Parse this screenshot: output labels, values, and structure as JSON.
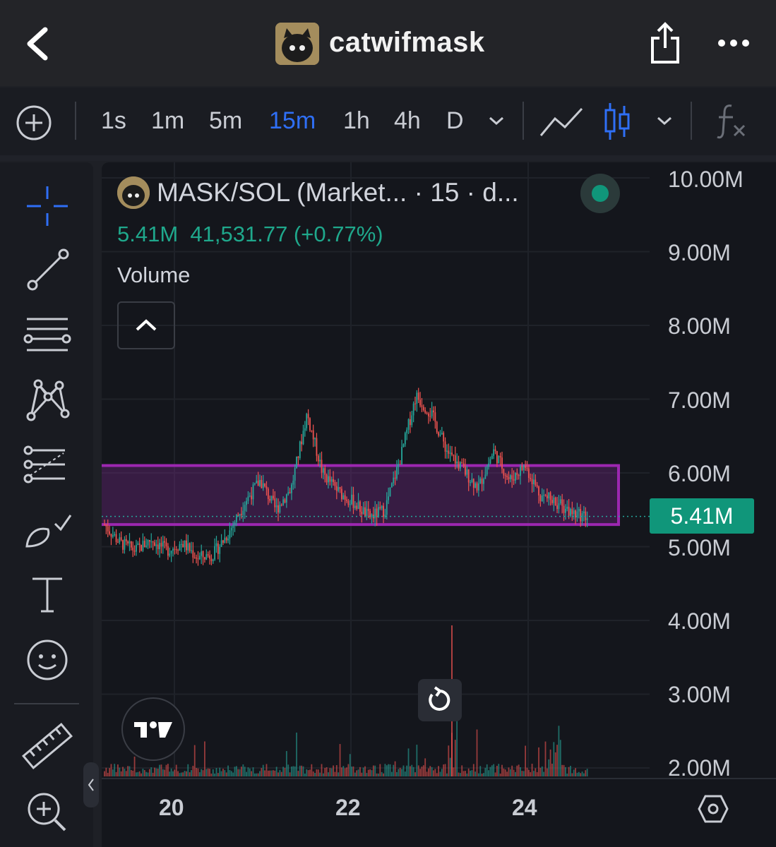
{
  "header": {
    "title": "catwifmask"
  },
  "toolbar": {
    "timeframes": [
      "1s",
      "1m",
      "5m",
      "15m",
      "1h",
      "4h",
      "D"
    ],
    "active_timeframe": "15m",
    "accent_color": "#2f6ff6"
  },
  "legend": {
    "symbol": "MASK/SOL (Market... · 15 · d...",
    "price": "5.41M",
    "change": "41,531.77 (+0.77%)",
    "indicator": "Volume",
    "status_color": "#10967a"
  },
  "axis": {
    "price_labels": [
      "10.00M",
      "9.00M",
      "8.00M",
      "7.00M",
      "6.00M",
      "5.00M",
      "4.00M",
      "3.00M",
      "2.00M"
    ],
    "current_price_label": "5.41M",
    "date_labels": [
      "20",
      "22",
      "24"
    ]
  },
  "chart_data": {
    "type": "candlestick",
    "title": "MASK/SOL",
    "interval": "15m",
    "ylim": [
      2000000,
      10000000
    ],
    "x_labels": [
      "20",
      "22",
      "24"
    ],
    "last_price": 5410000,
    "rectangle_zone": {
      "from": 5300000,
      "to": 6100000,
      "color": "#9c27b0"
    },
    "series": [
      {
        "name": "price",
        "values": [
          5.3,
          5.05,
          4.95,
          5.1,
          4.95,
          5.05,
          4.85,
          4.9,
          5.2,
          5.6,
          5.9,
          5.5,
          5.8,
          6.8,
          6.0,
          5.75,
          5.6,
          5.4,
          5.5,
          6.2,
          7.05,
          6.8,
          6.3,
          6.05,
          5.8,
          6.3,
          5.9,
          6.1,
          5.7,
          5.6,
          5.45,
          5.41
        ]
      }
    ],
    "up_color": "#26a69a",
    "down_color": "#ef5350"
  }
}
